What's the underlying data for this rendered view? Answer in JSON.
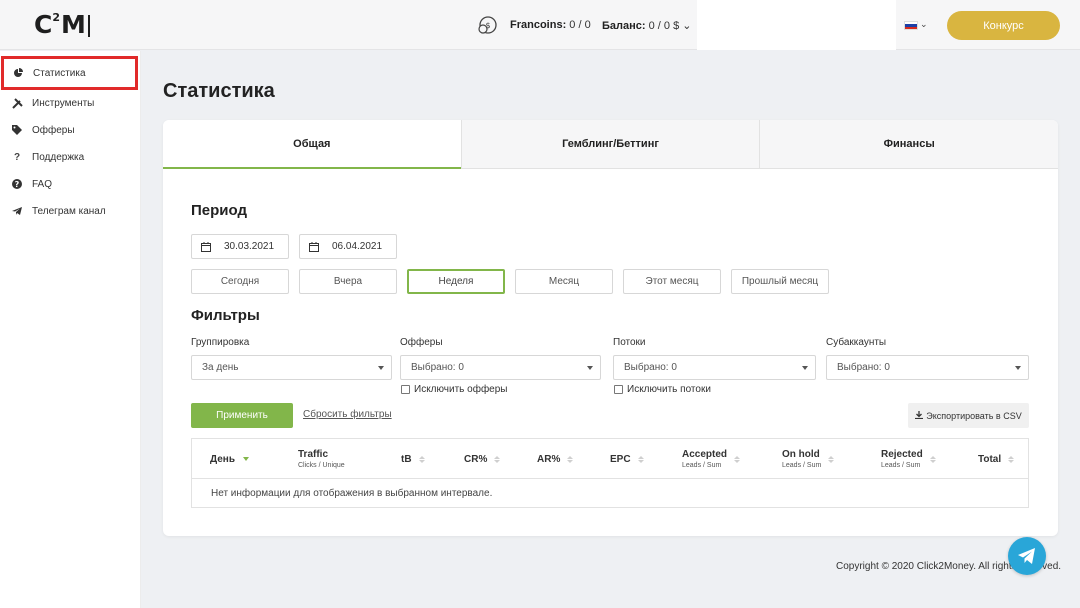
{
  "header": {
    "logo": {
      "left": "C",
      "sup": "2",
      "right": "M"
    },
    "francoins": {
      "label": "Francoins:",
      "value": "0 / 0"
    },
    "balance": {
      "label": "Баланс:",
      "value": "0 / 0 $"
    },
    "language": {
      "icon": "russia-flag-icon",
      "colors": [
        "#ffffff",
        "#1c3fa6",
        "#d52b1e"
      ]
    },
    "contest_button": "Конкурс",
    "accent_color": "#d9b540"
  },
  "sidebar": {
    "items": [
      {
        "label": "Статистика",
        "icon": "pie-chart-icon",
        "active": true
      },
      {
        "label": "Инструменты",
        "icon": "tools-icon"
      },
      {
        "label": "Офферы",
        "icon": "tag-icon"
      },
      {
        "label": "Поддержка",
        "icon": "question-icon"
      },
      {
        "label": "FAQ",
        "icon": "question-circle-icon"
      },
      {
        "label": "Телеграм канал",
        "icon": "telegram-icon"
      }
    ]
  },
  "main": {
    "title": "Статистика",
    "tabs": [
      {
        "label": "Общая",
        "active": true
      },
      {
        "label": "Гемблинг/Беттинг"
      },
      {
        "label": "Финансы"
      }
    ],
    "period": {
      "title": "Период",
      "date_from": "30.03.2021",
      "date_to": "06.04.2021",
      "presets": [
        {
          "label": "Сегодня"
        },
        {
          "label": "Вчера"
        },
        {
          "label": "Неделя",
          "active": true
        },
        {
          "label": "Месяц"
        },
        {
          "label": "Этот месяц"
        },
        {
          "label": "Прошлый месяц"
        }
      ]
    },
    "filters": {
      "title": "Фильтры",
      "grouping": {
        "label": "Группировка",
        "value": "За день"
      },
      "offers": {
        "label": "Офферы",
        "value": "Выбрано: 0",
        "checkbox": "Исключить офферы"
      },
      "streams": {
        "label": "Потоки",
        "value": "Выбрано: 0",
        "checkbox": "Исключить потоки"
      },
      "subaccounts": {
        "label": "Субаккаунты",
        "value": "Выбрано: 0"
      },
      "apply": "Применить",
      "reset": "Сбросить фильтры",
      "export": "Экспортировать в CSV"
    },
    "table": {
      "columns": [
        {
          "label": "День",
          "sub": ""
        },
        {
          "label": "Traffic",
          "sub": "Clicks / Unique"
        },
        {
          "label": "tB",
          "sub": ""
        },
        {
          "label": "CR%",
          "sub": ""
        },
        {
          "label": "AR%",
          "sub": ""
        },
        {
          "label": "EPC",
          "sub": ""
        },
        {
          "label": "Accepted",
          "sub": "Leads / Sum"
        },
        {
          "label": "On hold",
          "sub": "Leads / Sum"
        },
        {
          "label": "Rejected",
          "sub": "Leads / Sum"
        },
        {
          "label": "Total",
          "sub": ""
        }
      ],
      "empty_message": "Нет информации для отображения в выбранном интервале."
    },
    "primary_color": "#82b64a"
  },
  "footer": {
    "copyright": "Copyright © 2020 Click2Money. All rights reserved."
  }
}
